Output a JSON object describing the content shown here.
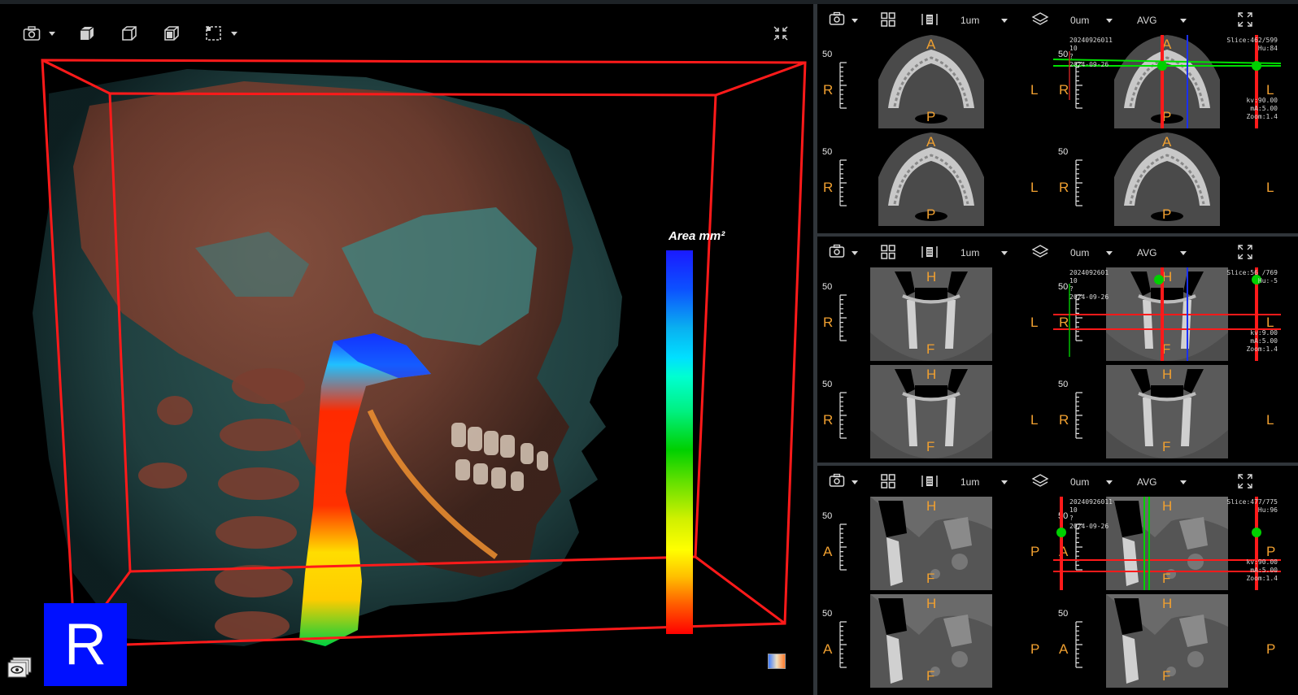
{
  "view3d": {
    "toolbar": [
      {
        "name": "camera-icon",
        "has_menu": true
      },
      {
        "name": "cube-solid-icon",
        "has_menu": false
      },
      {
        "name": "cube-wire-icon",
        "has_menu": false
      },
      {
        "name": "cube-clip-icon",
        "has_menu": false
      },
      {
        "name": "crop-select-icon",
        "has_menu": true
      }
    ],
    "collapse_icon": "collapse-icon",
    "legend": {
      "title": "Area mm²",
      "gradient_colors": [
        "#1a1aff",
        "#00e0ff",
        "#00d000",
        "#ffff00",
        "#ff0000"
      ]
    },
    "orientation_badge": "R",
    "box_color": "#ff1a1a"
  },
  "panels": [
    {
      "id": "axial",
      "toolbar": {
        "thickness": "1um",
        "offset": "0um",
        "mode": "AVG"
      },
      "cells": [
        {
          "scale": "50",
          "left": "R",
          "right": "L",
          "top": "A",
          "bottom": "P",
          "active": false
        },
        {
          "scale": "50",
          "left": "R",
          "right": "L",
          "top": "A",
          "bottom": "P",
          "active": true,
          "info_left": [
            "20240926011",
            "10",
            "?",
            "2024-09-26"
          ],
          "info_right": [
            "Slice:462/599",
            "Hu:84"
          ],
          "info_right_bottom": [
            "kv:90.00",
            "mA:5.00",
            "Zoom:1.4"
          ]
        },
        {
          "scale": "50",
          "left": "R",
          "right": "L",
          "top": "A",
          "bottom": "P",
          "active": false
        },
        {
          "scale": "50",
          "left": "R",
          "right": "L",
          "top": "A",
          "bottom": "P",
          "active": false
        }
      ]
    },
    {
      "id": "coronal",
      "toolbar": {
        "thickness": "1um",
        "offset": "0um",
        "mode": "AVG"
      },
      "cells": [
        {
          "scale": "50",
          "left": "R",
          "right": "L",
          "top": "H",
          "bottom": "F",
          "active": false
        },
        {
          "scale": "50",
          "left": "R",
          "right": "L",
          "top": "H",
          "bottom": "F",
          "active": true,
          "info_left": [
            "2024092601",
            "10",
            "?",
            "2024-09-26"
          ],
          "info_right": [
            "Slice:56 /769",
            "Hu:-5"
          ],
          "info_right_bottom": [
            "kv:9.00",
            "mA:5.00",
            "Zoom:1.4"
          ]
        },
        {
          "scale": "50",
          "left": "R",
          "right": "L",
          "top": "H",
          "bottom": "F",
          "active": false
        },
        {
          "scale": "50",
          "left": "R",
          "right": "L",
          "top": "H",
          "bottom": "F",
          "active": false
        }
      ]
    },
    {
      "id": "sagittal",
      "toolbar": {
        "thickness": "1um",
        "offset": "0um",
        "mode": "AVG"
      },
      "cells": [
        {
          "scale": "50",
          "left": "A",
          "right": "P",
          "top": "H",
          "bottom": "F",
          "active": false
        },
        {
          "scale": "50",
          "left": "A",
          "right": "P",
          "top": "H",
          "bottom": "F",
          "active": true,
          "info_left": [
            "20240926011",
            "10",
            "?",
            "2024-09-26"
          ],
          "info_right": [
            "Slice:477/775",
            "Hu:96"
          ],
          "info_right_bottom": [
            "kv:90.00",
            "mA:5.00",
            "Zoom:1.4"
          ]
        },
        {
          "scale": "50",
          "left": "A",
          "right": "P",
          "top": "H",
          "bottom": "F",
          "active": false
        },
        {
          "scale": "50",
          "left": "A",
          "right": "P",
          "top": "H",
          "bottom": "F",
          "active": false
        }
      ]
    }
  ]
}
